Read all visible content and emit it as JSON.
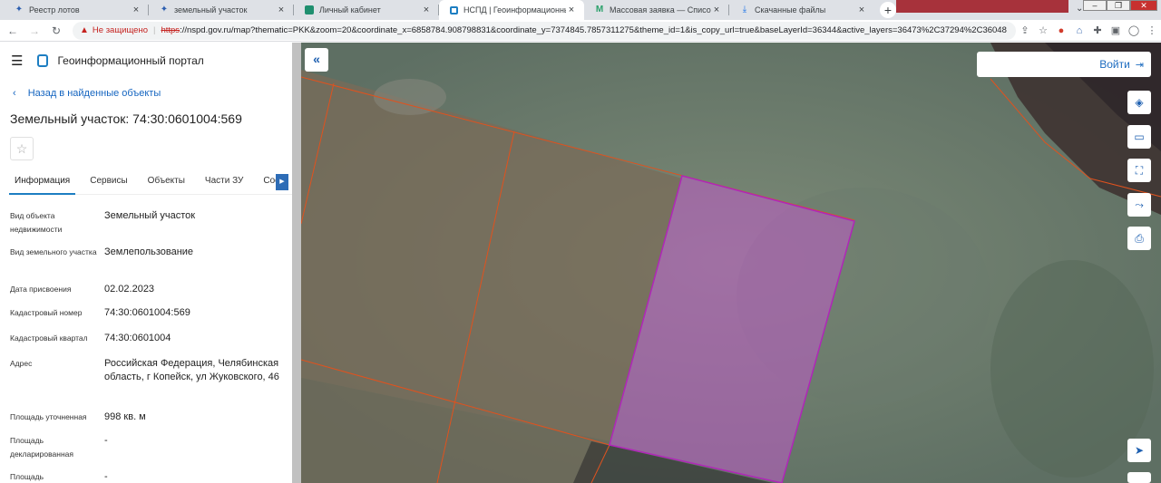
{
  "browser": {
    "tabs": [
      {
        "label": "Реестр лотов",
        "icon": "crest-icon",
        "active": false
      },
      {
        "label": "земельный участок",
        "icon": "crest-icon",
        "active": false
      },
      {
        "label": "Личный кабинет",
        "icon": "cabinet-icon",
        "active": false
      },
      {
        "label": "НСПД | Геоинформационный п",
        "icon": "nspd-icon",
        "active": true
      },
      {
        "label": "Массовая заявка — Список зая",
        "icon": "mail-icon",
        "active": false
      },
      {
        "label": "Скачанные файлы",
        "icon": "download-icon",
        "active": false
      }
    ],
    "insecure_label": "Не защищено",
    "url_scheme": "https",
    "url_rest": "://nspd.gov.ru/map?thematic=PKK&zoom=20&coordinate_x=6858784.908798831&coordinate_y=7374845.7857311275&theme_id=1&is_copy_url=true&baseLayerId=36344&active_layers=36473%2C37294%2C36048"
  },
  "header": {
    "portal_title": "Геоинформационный портал"
  },
  "back_link": "Назад в найденные объекты",
  "object_title": "Земельный участок: 74:30:0601004:569",
  "tabs": [
    "Информация",
    "Сервисы",
    "Объекты",
    "Части ЗУ",
    "Сост"
  ],
  "properties": [
    {
      "key": "Вид объекта недвижимости",
      "value": "Земельный участок"
    },
    {
      "key": "Вид земельного участка",
      "value": "Землепользование"
    },
    {
      "key": "Дата присвоения",
      "value": "02.02.2023"
    },
    {
      "key": "Кадастровый номер",
      "value": "74:30:0601004:569"
    },
    {
      "key": "Кадастровый квартал",
      "value": "74:30:0601004"
    },
    {
      "key": "Адрес",
      "value": "Российская Федерация, Челябинская область, г Копейск, ул Жуковского, 46"
    },
    {
      "key": "Площадь уточненная",
      "value": "998 кв. м"
    },
    {
      "key": "Площадь декларированная",
      "value": "-"
    },
    {
      "key": "Площадь",
      "value": "-"
    }
  ],
  "map": {
    "login_label": "Войти",
    "parcel_color": "#c05bc8",
    "boundary_color": "#e0521e"
  }
}
